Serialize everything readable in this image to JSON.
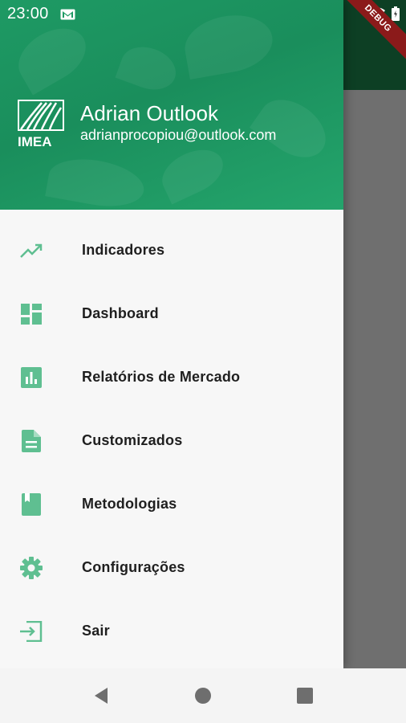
{
  "status_bar": {
    "time": "23:00",
    "debug_label": "DEBUG"
  },
  "drawer": {
    "header": {
      "logo_text": "IMEA",
      "user_name": "Adrian Outlook",
      "user_email": "adrianprocopiou@outlook.com"
    },
    "items": [
      {
        "label": "Indicadores",
        "icon": "trending-up-icon"
      },
      {
        "label": "Dashboard",
        "icon": "dashboard-icon"
      },
      {
        "label": "Relatórios de Mercado",
        "icon": "bar-chart-icon"
      },
      {
        "label": "Customizados",
        "icon": "document-icon"
      },
      {
        "label": "Metodologias",
        "icon": "book-icon"
      },
      {
        "label": "Configurações",
        "icon": "gear-icon"
      },
      {
        "label": "Sair",
        "icon": "exit-icon"
      }
    ]
  },
  "colors": {
    "accent": "#1e9a64",
    "icon": "#5fbf91",
    "app_bar": "#0d3f24"
  }
}
